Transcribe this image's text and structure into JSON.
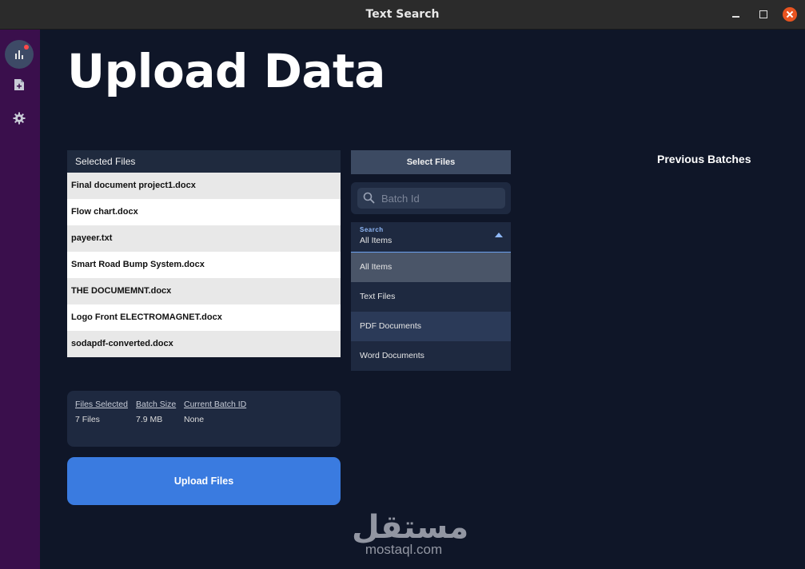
{
  "window": {
    "title": "Text Search"
  },
  "sidebar": {
    "items": [
      {
        "icon": "bar-chart-icon",
        "active": true
      },
      {
        "icon": "document-icon"
      },
      {
        "icon": "gear-icon"
      }
    ]
  },
  "page": {
    "title": "Upload Data"
  },
  "files": {
    "header": "Selected Files",
    "rows": [
      "Final document project1.docx",
      "Flow chart.docx",
      "payeer.txt",
      "Smart Road Bump System.docx",
      "THE DOCUMEMNT.docx",
      "Logo Front ELECTROMAGNET.docx",
      "sodapdf-converted.docx"
    ]
  },
  "select_files": {
    "label": "Select Files"
  },
  "search": {
    "placeholder": "Batch Id"
  },
  "dropdown": {
    "label": "Search",
    "value": "All Items",
    "options": [
      "All Items",
      "Text Files",
      "PDF Documents",
      "Word Documents"
    ]
  },
  "previous_batches": {
    "title": "Previous Batches"
  },
  "stats": {
    "files_selected": {
      "label": "Files Selected",
      "value": "7 Files"
    },
    "batch_size": {
      "label": "Batch Size",
      "value": "7.9 MB"
    },
    "current_batch": {
      "label": "Current Batch ID",
      "value": "None"
    }
  },
  "upload": {
    "label": "Upload Files"
  },
  "watermark": {
    "arabic": "مستقل",
    "latin": "mostaql.com"
  },
  "colors": {
    "accent": "#3a7be0",
    "sidebar": "#3a0f4c",
    "background": "#0f1628",
    "close": "#e95420"
  }
}
